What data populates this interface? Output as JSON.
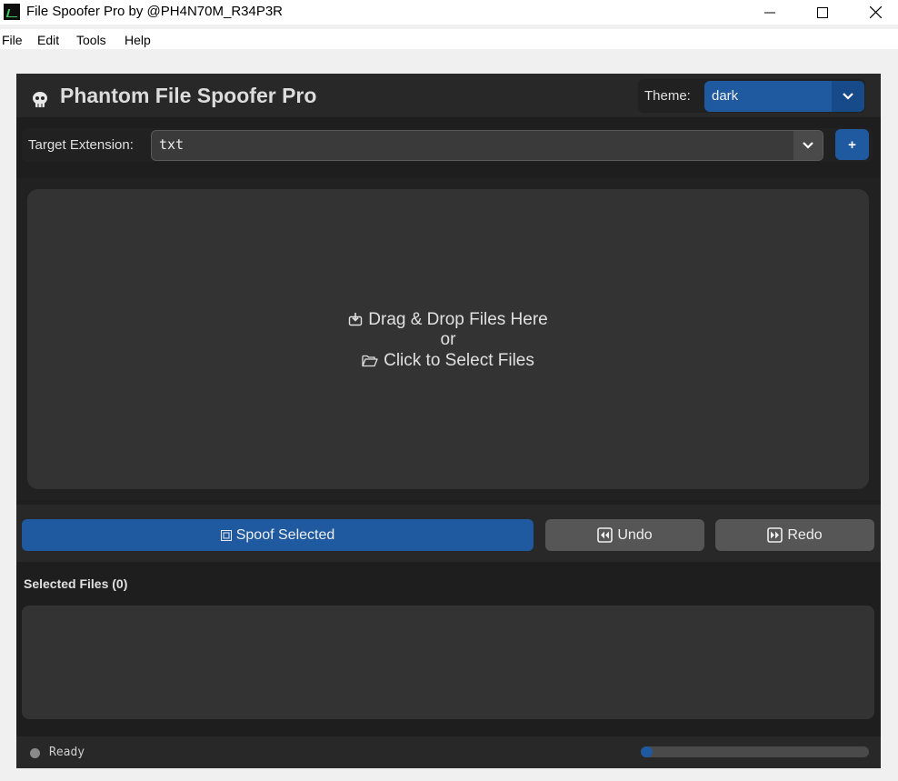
{
  "window": {
    "title": "File Spoofer Pro by @PH4N70M_R34P3R"
  },
  "menu": [
    "File",
    "Edit",
    "Tools",
    "Help"
  ],
  "header": {
    "title": "Phantom File Spoofer Pro",
    "theme_label": "Theme:",
    "theme_value": "dark"
  },
  "extension": {
    "label": "Target Extension:",
    "value": "txt",
    "add_label": "+"
  },
  "drop_zone": {
    "line1": "Drag & Drop Files Here",
    "line2": "or",
    "line3": "Click to Select Files"
  },
  "actions": {
    "spoof_label": "Spoof Selected",
    "undo_label": "Undo",
    "redo_label": "Redo"
  },
  "files": {
    "label": "Selected Files (0)"
  },
  "status": {
    "text": "Ready",
    "progress": 0.05
  },
  "colors": {
    "accent": "#1f5aa0",
    "panel_bg": "#1e1e1e",
    "secondary_button": "#565656"
  }
}
